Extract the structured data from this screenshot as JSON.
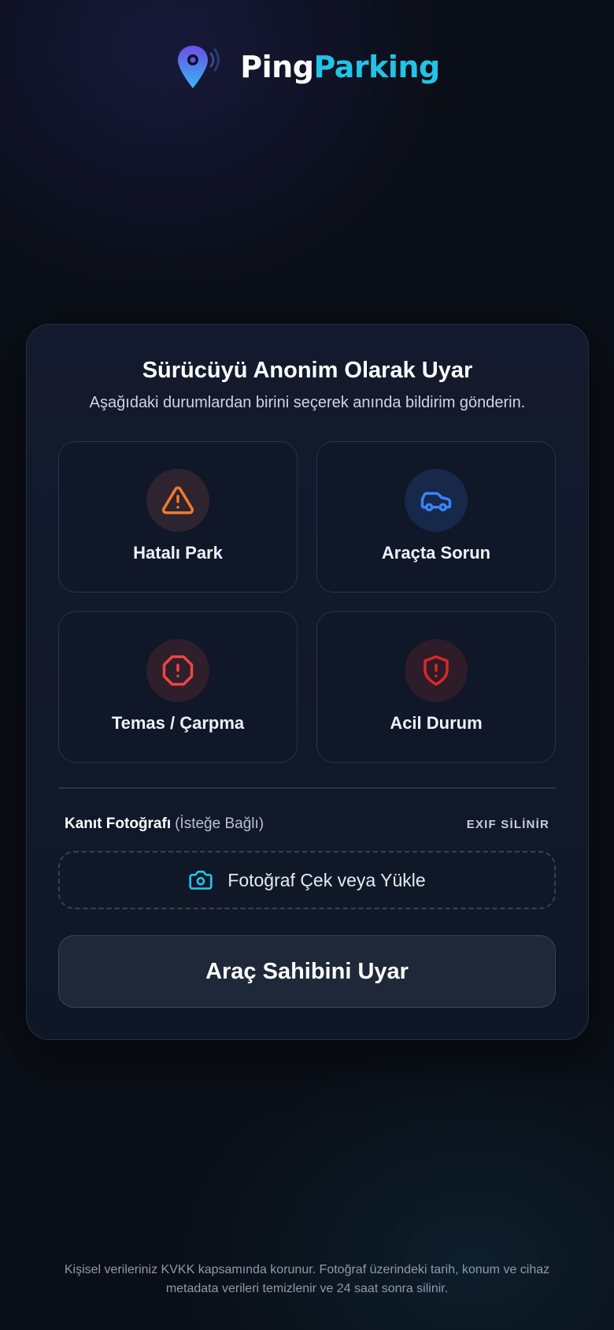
{
  "brand": {
    "name_part1": "Ping",
    "name_part2": "Parking",
    "logo_icon": "map-pin-signal-icon",
    "accent_color": "#22c3e6"
  },
  "card": {
    "title": "Sürücüyü Anonim Olarak Uyar",
    "subtitle": "Aşağıdaki durumlardan birini seçerek anında bildirim gönderin.",
    "options": [
      {
        "label": "Hatalı Park",
        "icon": "warning-triangle-icon",
        "color": "#f07a2a"
      },
      {
        "label": "Araçta Sorun",
        "icon": "car-icon",
        "color": "#3b82f6"
      },
      {
        "label": "Temas / Çarpma",
        "icon": "octagon-alert-icon",
        "color": "#ef4444"
      },
      {
        "label": "Acil Durum",
        "icon": "shield-alert-icon",
        "color": "#dc2626"
      }
    ],
    "evidence": {
      "title": "Kanıt Fotoğrafı",
      "optional": "(İsteğe Bağlı)",
      "exif_note": "EXIF SİLİNİR"
    },
    "upload": {
      "label": "Fotoğraf Çek veya Yükle",
      "icon": "camera-icon"
    },
    "submit_label": "Araç Sahibini Uyar"
  },
  "footer": {
    "privacy_note": "Kişisel verileriniz KVKK kapsamında korunur. Fotoğraf üzerindeki tarih, konum ve cihaz metadata verileri temizlenir ve 24 saat sonra silinir."
  }
}
